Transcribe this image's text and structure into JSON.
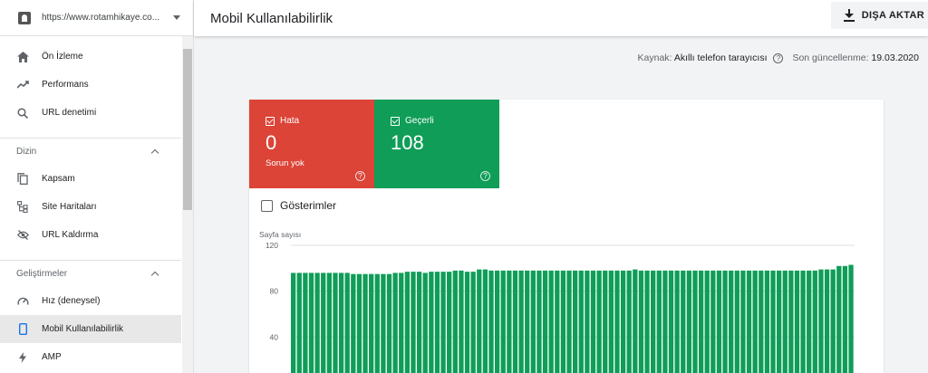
{
  "property": {
    "url": "https://www.rotamhikaye.co..."
  },
  "nav": {
    "top_items": [
      {
        "label": "Ön İzleme",
        "icon": "home-icon"
      },
      {
        "label": "Performans",
        "icon": "trending-up-icon"
      },
      {
        "label": "URL denetimi",
        "icon": "search-icon"
      }
    ],
    "index_section": {
      "label": "Dizin",
      "items": [
        {
          "label": "Kapsam",
          "icon": "copy-icon"
        },
        {
          "label": "Site Haritaları",
          "icon": "sitemap-icon"
        },
        {
          "label": "URL Kaldırma",
          "icon": "eye-off-icon"
        }
      ]
    },
    "enh_section": {
      "label": "Geliştirmeler",
      "items": [
        {
          "label": "Hız (deneysel)",
          "icon": "speed-icon"
        },
        {
          "label": "Mobil Kullanılabilirlik",
          "icon": "phone-icon",
          "active": true
        },
        {
          "label": "AMP",
          "icon": "bolt-icon"
        }
      ]
    }
  },
  "header": {
    "title": "Mobil Kullanılabilirlik",
    "export_label": "DIŞA AKTAR"
  },
  "meta": {
    "source_label": "Kaynak:",
    "source_value": "Akıllı telefon tarayıcısı",
    "updated_label": "Son güncellenme:",
    "updated_value": "19.03.2020"
  },
  "tiles": {
    "error": {
      "label": "Hata",
      "count": "0",
      "sub": "Sorun yok",
      "color": "#db4437"
    },
    "valid": {
      "label": "Geçerli",
      "count": "108",
      "color": "#0f9d58"
    }
  },
  "impressions_label": "Gösterimler",
  "chart_data": {
    "type": "bar",
    "ylabel": "Sayfa sayısı",
    "ylim": [
      0,
      120
    ],
    "yticks": [
      0,
      40,
      80,
      120
    ],
    "color": "#0f9d58",
    "grid": true,
    "values": [
      96,
      96,
      96,
      96,
      96,
      96,
      96,
      96,
      96,
      96,
      95,
      95,
      95,
      95,
      95,
      95,
      95,
      96,
      96,
      97,
      97,
      97,
      96,
      97,
      97,
      97,
      97,
      98,
      98,
      97,
      97,
      99,
      99,
      98,
      98,
      98,
      98,
      98,
      98,
      98,
      98,
      98,
      98,
      98,
      98,
      98,
      98,
      98,
      98,
      98,
      98,
      98,
      98,
      98,
      98,
      98,
      98,
      99,
      98,
      98,
      98,
      98,
      98,
      98,
      98,
      98,
      98,
      98,
      98,
      98,
      98,
      98,
      98,
      98,
      98,
      98,
      98,
      98,
      98,
      98,
      98,
      98,
      98,
      98,
      98,
      98,
      98,
      98,
      99,
      99,
      99,
      102,
      102,
      103
    ]
  }
}
